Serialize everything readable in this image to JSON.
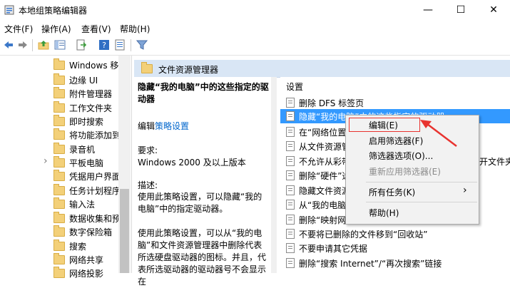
{
  "window": {
    "title": "本地组策略编辑器",
    "minimize": "—",
    "maximize": "☐",
    "close": "✕"
  },
  "menu": [
    "文件(F)",
    "操作(A)",
    "查看(V)",
    "帮助(H)"
  ],
  "tree_items": [
    "Windows 移",
    "边缘 UI",
    "附件管理器",
    "工作文件夹",
    "即时搜索",
    "将功能添加到",
    "录音机",
    "平板电脑",
    "凭据用户界面",
    "任务计划程序",
    "输入法",
    "数据收集和预",
    "数字保险箱",
    "搜索",
    "网络共享",
    "网络投影"
  ],
  "tree_expander": "›",
  "header": {
    "title": "文件资源管理器"
  },
  "description": {
    "title": "隐藏“我的电脑”中的这些指定的驱动器",
    "edit_prefix": "编辑",
    "edit_link": "策略设置",
    "req_label": "要求:",
    "req_value": "Windows 2000 及以上版本",
    "desc_label": "描述:",
    "desc_text": "使用此策略设置，可以隐藏“我的电脑”中的指定驱动器。",
    "desc_text2": "使用此策略设置，可以从“我的电脑”和文件资源管理器中删除代表所选硬盘驱动器的图标。并且，代表所选驱动器的驱动器号不会显示在"
  },
  "list": {
    "header": "设置",
    "items": [
      "删除 DFS 标签页",
      "隐藏“我的电脑”中的这些指定的驱动器",
      "在“网络位置",
      "从文件资源管",
      "不允许从彩带",
      "删除“硬件”选",
      "隐藏文件资源",
      "从“我的电脑”",
      "删除“映射网络",
      "不要将已删除的文件移到“回收站”",
      "不要申请其它凭据",
      "删除“搜索 Internet”/“再次搜索”链接"
    ],
    "trailing_text": "开文件夹"
  },
  "context_menu": {
    "items": [
      "编辑(E)",
      "启用筛选器(F)",
      "筛选器选项(O)...",
      "重新应用筛选器(E)",
      "所有任务(K)",
      "帮助(H)"
    ],
    "submenu_arrow": "›"
  },
  "colors": {
    "selection": "#3399ff",
    "annotation": "#e8332f",
    "header_bg": "#d9e6f5",
    "link": "#0066cc"
  }
}
